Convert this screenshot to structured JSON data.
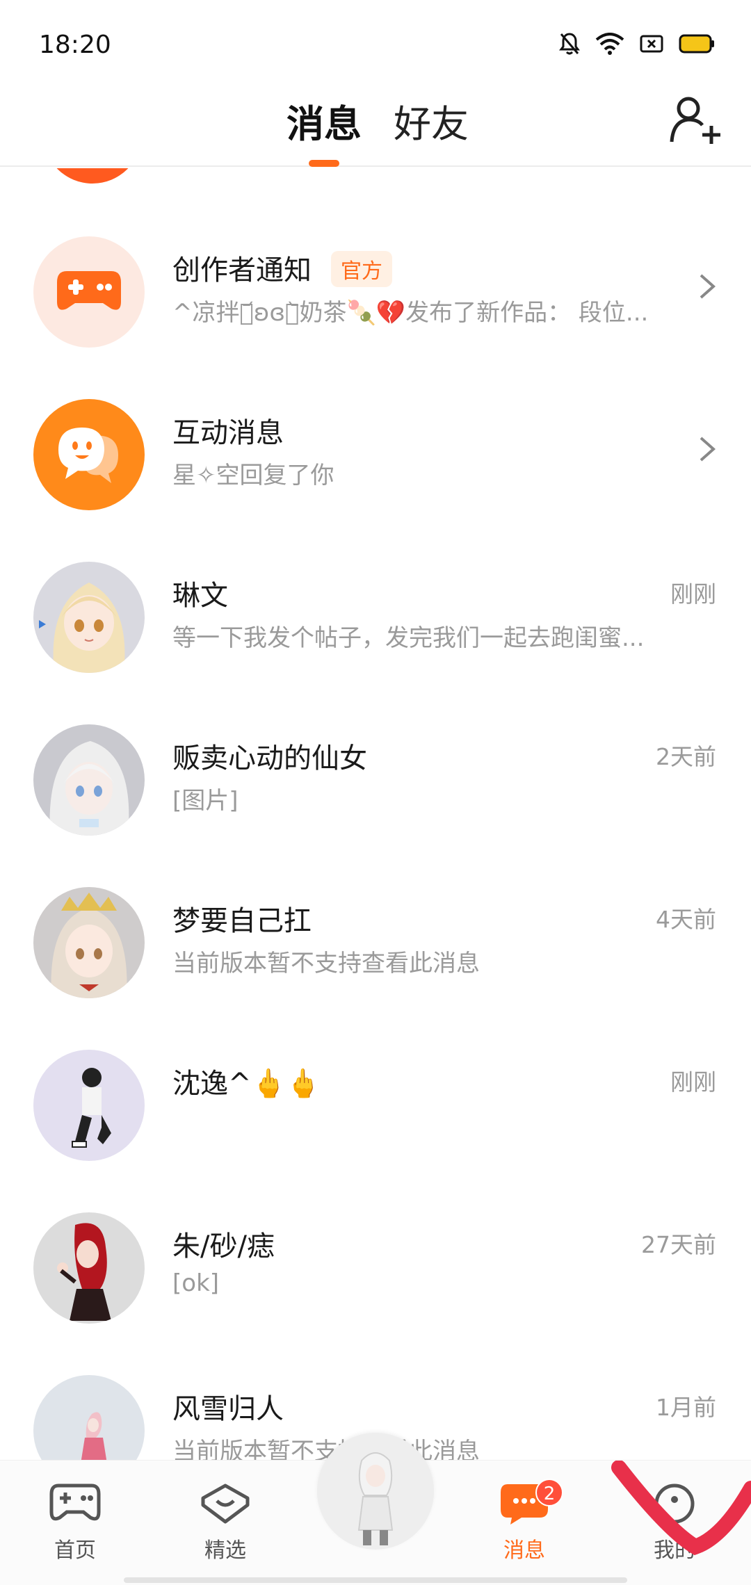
{
  "status_bar": {
    "time": "18:20"
  },
  "header": {
    "tabs": [
      {
        "label": "消息",
        "active": true
      },
      {
        "label": "好友",
        "active": false
      }
    ],
    "add_friend_icon": "add-person-icon"
  },
  "conversations": [
    {
      "title": "创作者通知",
      "badge": "官方",
      "subtitle": "^凉拌꒰᷄ʚɞ꒱᷅奶茶🍡💔发布了新作品： 段位...",
      "time": "",
      "avatar": "gamepad-icon",
      "avatar_bg": "#fde9e1",
      "accessory": "chevron"
    },
    {
      "title": "互动消息",
      "badge": "",
      "subtitle": "星✧空回复了你",
      "time": "",
      "avatar": "chat-face-icon",
      "avatar_bg": "#ff8a1a",
      "accessory": "chevron"
    },
    {
      "title": "琳文",
      "badge": "",
      "subtitle": "等一下我发个帖子，发完我们一起去跑闺蜜...",
      "time": "刚刚",
      "avatar": "anime-girl-blonde",
      "avatar_bg": "#d9d9e0"
    },
    {
      "title": "贩卖心动的仙女",
      "badge": "",
      "subtitle": "[图片]",
      "time": "2天前",
      "avatar": "anime-girl-white",
      "avatar_bg": "#c9c9cf"
    },
    {
      "title": "梦要自己扛",
      "badge": "",
      "subtitle": "当前版本暂不支持查看此消息",
      "time": "4天前",
      "avatar": "anime-girl-crown",
      "avatar_bg": "#cfcccc"
    },
    {
      "title": "沈逸^🖕🖕",
      "badge": "",
      "subtitle": "",
      "time": "刚刚",
      "avatar": "anime-boy-sitting",
      "avatar_bg": "#e3dff0"
    },
    {
      "title": "朱/砂/痣",
      "badge": "",
      "subtitle": "[ok]",
      "time": "27天前",
      "avatar": "anime-girl-red",
      "avatar_bg": "#dcdcdc"
    },
    {
      "title": "风雪归人",
      "badge": "",
      "subtitle": "当前版本暂不支持查看此消息",
      "time": "1月前",
      "avatar": "anime-girl-pink",
      "avatar_bg": "#dfe4ea"
    }
  ],
  "bottom_nav": {
    "items": [
      {
        "label": "首页",
        "icon": "gamepad-icon",
        "active": false
      },
      {
        "label": "精选",
        "icon": "heart-chat-icon",
        "active": false
      },
      {
        "label": "",
        "icon": "avatar-center",
        "active": false
      },
      {
        "label": "消息",
        "icon": "message-icon",
        "active": true,
        "badge": "2"
      },
      {
        "label": "我的",
        "icon": "profile-icon",
        "active": false
      }
    ]
  },
  "colors": {
    "accent": "#ff6a1a",
    "text_secondary": "#9a9a9a",
    "badge_red": "#ff4f3a",
    "annotation_red": "#e8304a"
  }
}
